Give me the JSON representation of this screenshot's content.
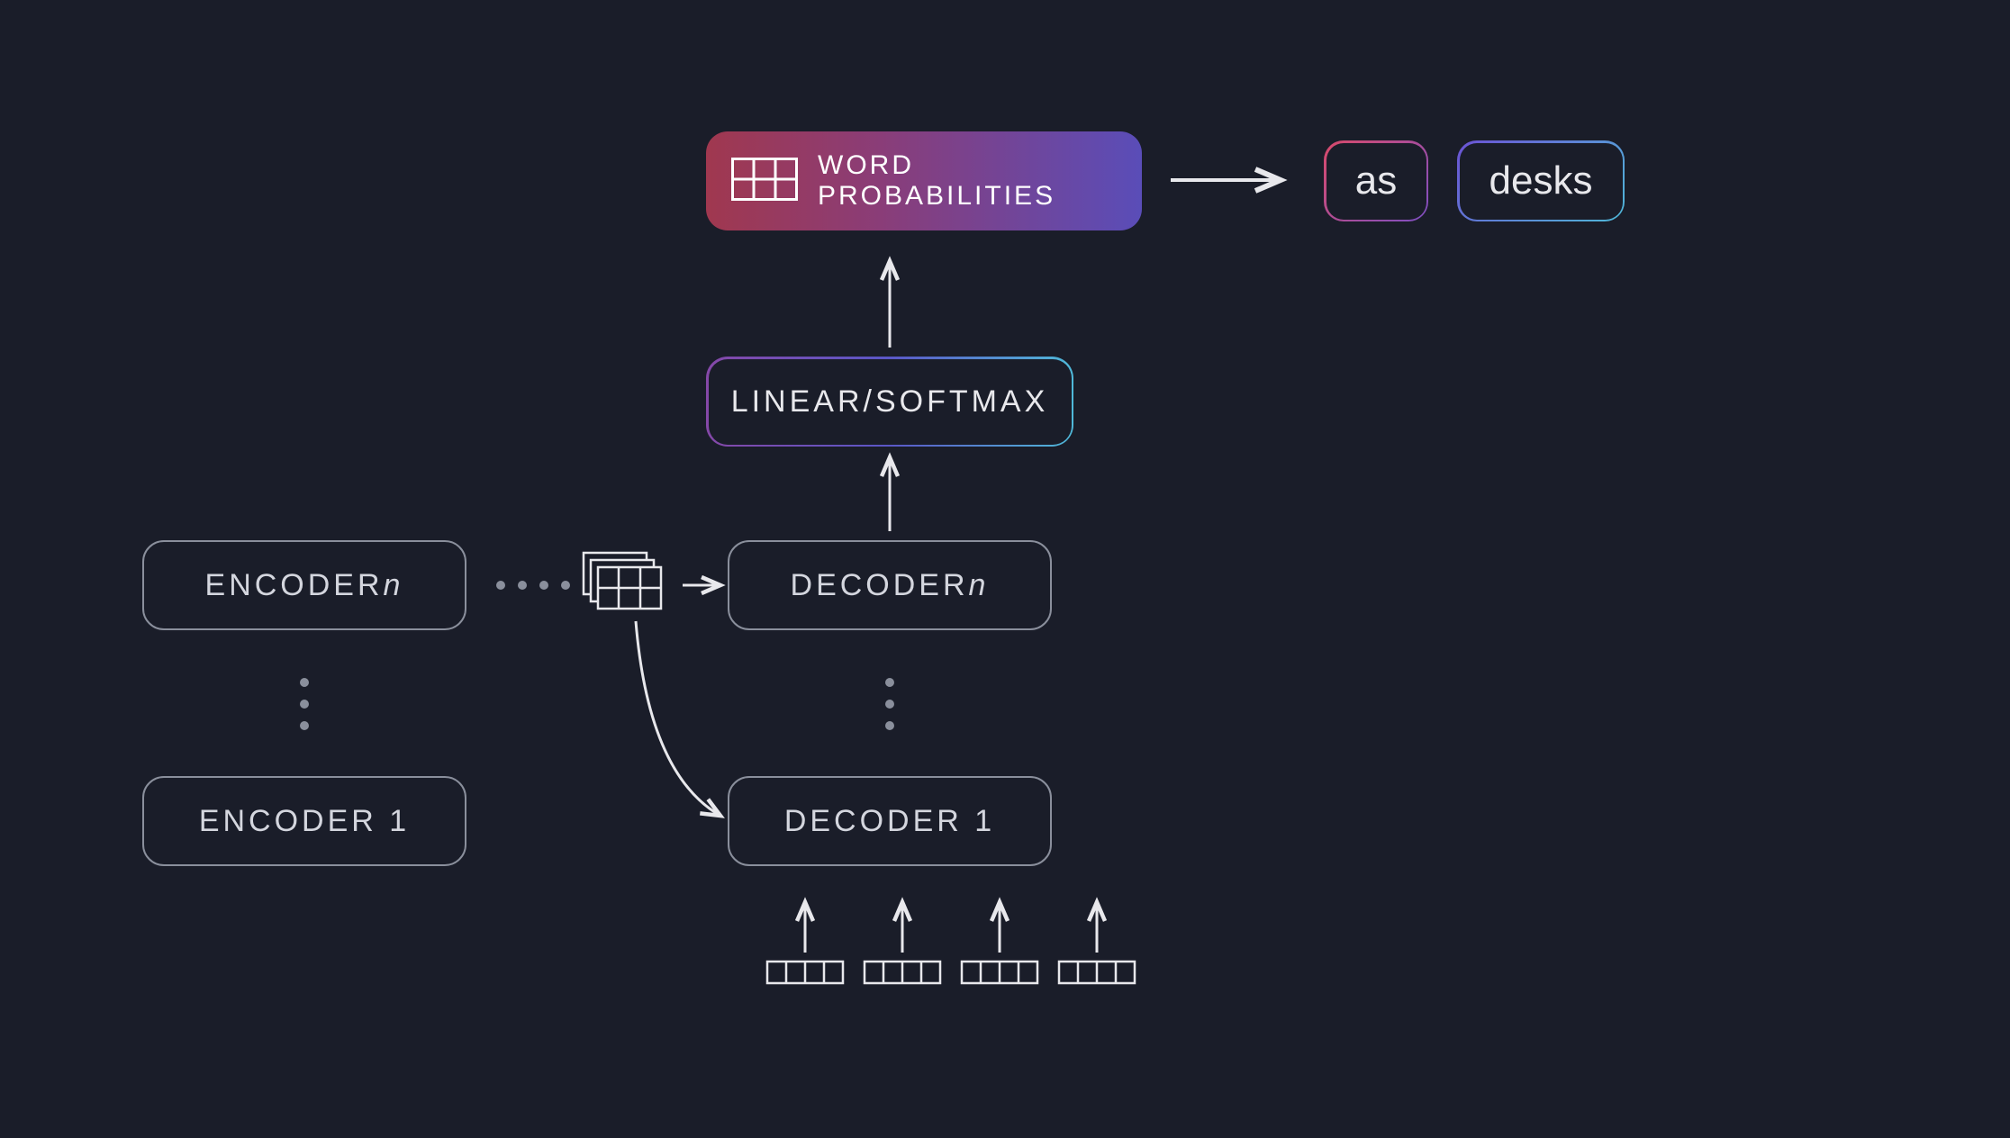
{
  "blocks": {
    "encoder_n_prefix": "ENCODER ",
    "encoder_n_suffix": "n",
    "encoder_1": "ENCODER 1",
    "decoder_n_prefix": "DECODER ",
    "decoder_n_suffix": "n",
    "decoder_1": "DECODER 1",
    "linear_softmax": "LINEAR/SOFTMAX",
    "word_prob_line1": "WORD",
    "word_prob_line2": "PROBABILITIES"
  },
  "outputs": {
    "word1": "as",
    "word2": "desks"
  }
}
